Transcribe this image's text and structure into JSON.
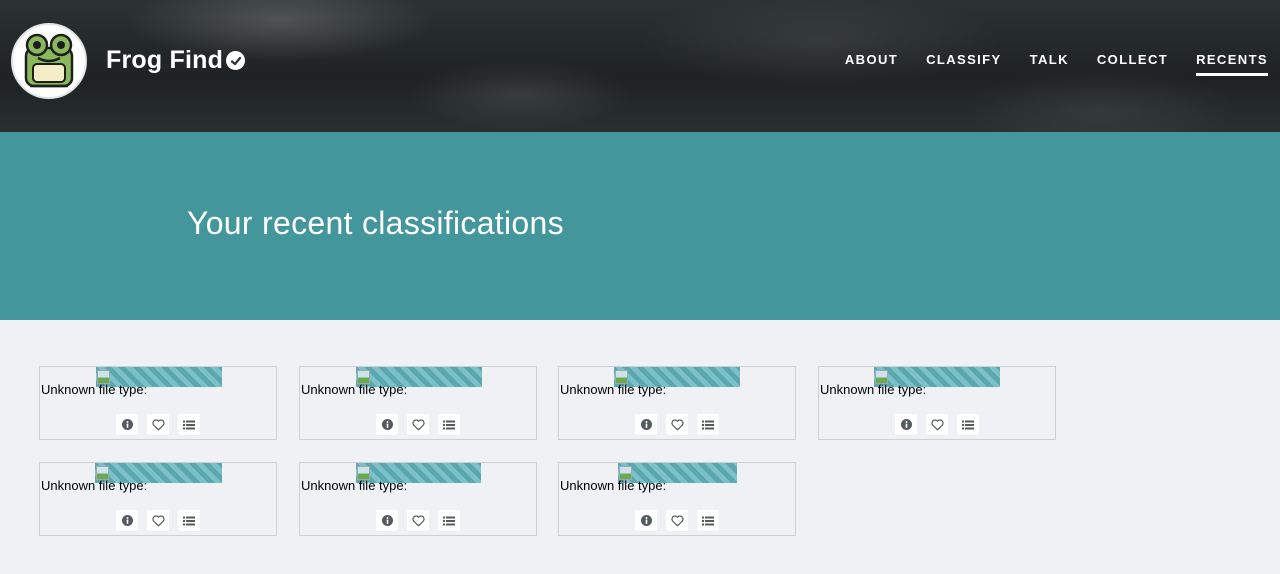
{
  "project": {
    "name": "Frog Find"
  },
  "nav": [
    {
      "label": "ABOUT",
      "active": false
    },
    {
      "label": "CLASSIFY",
      "active": false
    },
    {
      "label": "TALK",
      "active": false
    },
    {
      "label": "COLLECT",
      "active": false
    },
    {
      "label": "RECENTS",
      "active": true
    }
  ],
  "hero": {
    "title": "Your recent classifications"
  },
  "recents": [
    {
      "label": "Unknown file type:"
    },
    {
      "label": "Unknown file type:"
    },
    {
      "label": "Unknown file type:"
    },
    {
      "label": "Unknown file type:"
    },
    {
      "label": "Unknown file type:"
    },
    {
      "label": "Unknown file type:"
    },
    {
      "label": "Unknown file type:"
    }
  ],
  "icons": {
    "info": "info-icon",
    "favorite": "heart-icon",
    "collect": "list-icon",
    "verified": "check-badge-icon"
  },
  "colors": {
    "hero": "#43969c",
    "page": "#eff1f4",
    "header": "#232829"
  }
}
